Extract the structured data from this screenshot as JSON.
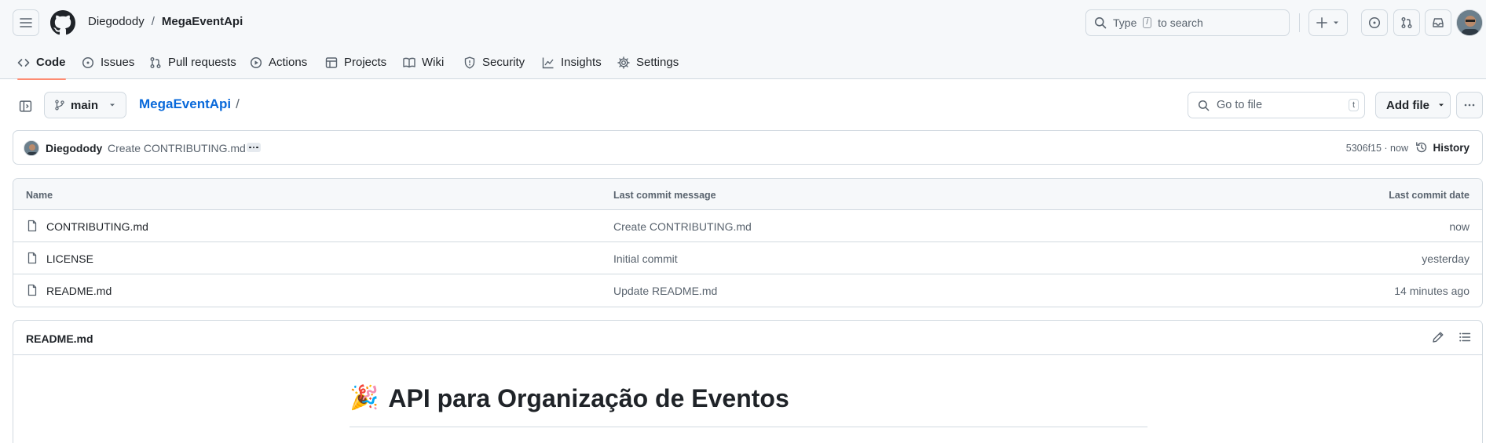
{
  "header": {
    "owner": "Diegodody",
    "separator": "/",
    "repo": "MegaEventApi",
    "search_placeholder_pre": "Type",
    "search_key": "/",
    "search_placeholder_post": "to search"
  },
  "tabs": [
    {
      "label": "Code",
      "icon": "code-icon",
      "active": true
    },
    {
      "label": "Issues",
      "icon": "issue-icon"
    },
    {
      "label": "Pull requests",
      "icon": "git-pull-request-icon"
    },
    {
      "label": "Actions",
      "icon": "play-icon"
    },
    {
      "label": "Projects",
      "icon": "table-icon"
    },
    {
      "label": "Wiki",
      "icon": "book-icon"
    },
    {
      "label": "Security",
      "icon": "shield-icon"
    },
    {
      "label": "Insights",
      "icon": "graph-icon"
    },
    {
      "label": "Settings",
      "icon": "gear-icon"
    }
  ],
  "repo_nav": {
    "branch": "main",
    "path_repo": "MegaEventApi",
    "path_sep": "/",
    "goto_placeholder": "Go to file",
    "goto_key": "t",
    "add_file": "Add file"
  },
  "commit": {
    "author": "Diegodody",
    "message": "Create CONTRIBUTING.md",
    "sha_time": "5306f15 · now",
    "history_label": "History"
  },
  "table": {
    "headers": {
      "name": "Name",
      "message": "Last commit message",
      "date": "Last commit date"
    },
    "rows": [
      {
        "name": "CONTRIBUTING.md",
        "message": "Create CONTRIBUTING.md",
        "date": "now"
      },
      {
        "name": "LICENSE",
        "message": "Initial commit",
        "date": "yesterday"
      },
      {
        "name": "README.md",
        "message": "Update README.md",
        "date": "14 minutes ago"
      }
    ]
  },
  "readme": {
    "filename": "README.md",
    "emoji": "🎉",
    "heading": "API para Organização de Eventos"
  },
  "colors": {
    "accent_tab_underline": "#fd8c73",
    "link": "#0969da",
    "border": "#d1d9e0",
    "header_bg": "#f6f8fa"
  }
}
